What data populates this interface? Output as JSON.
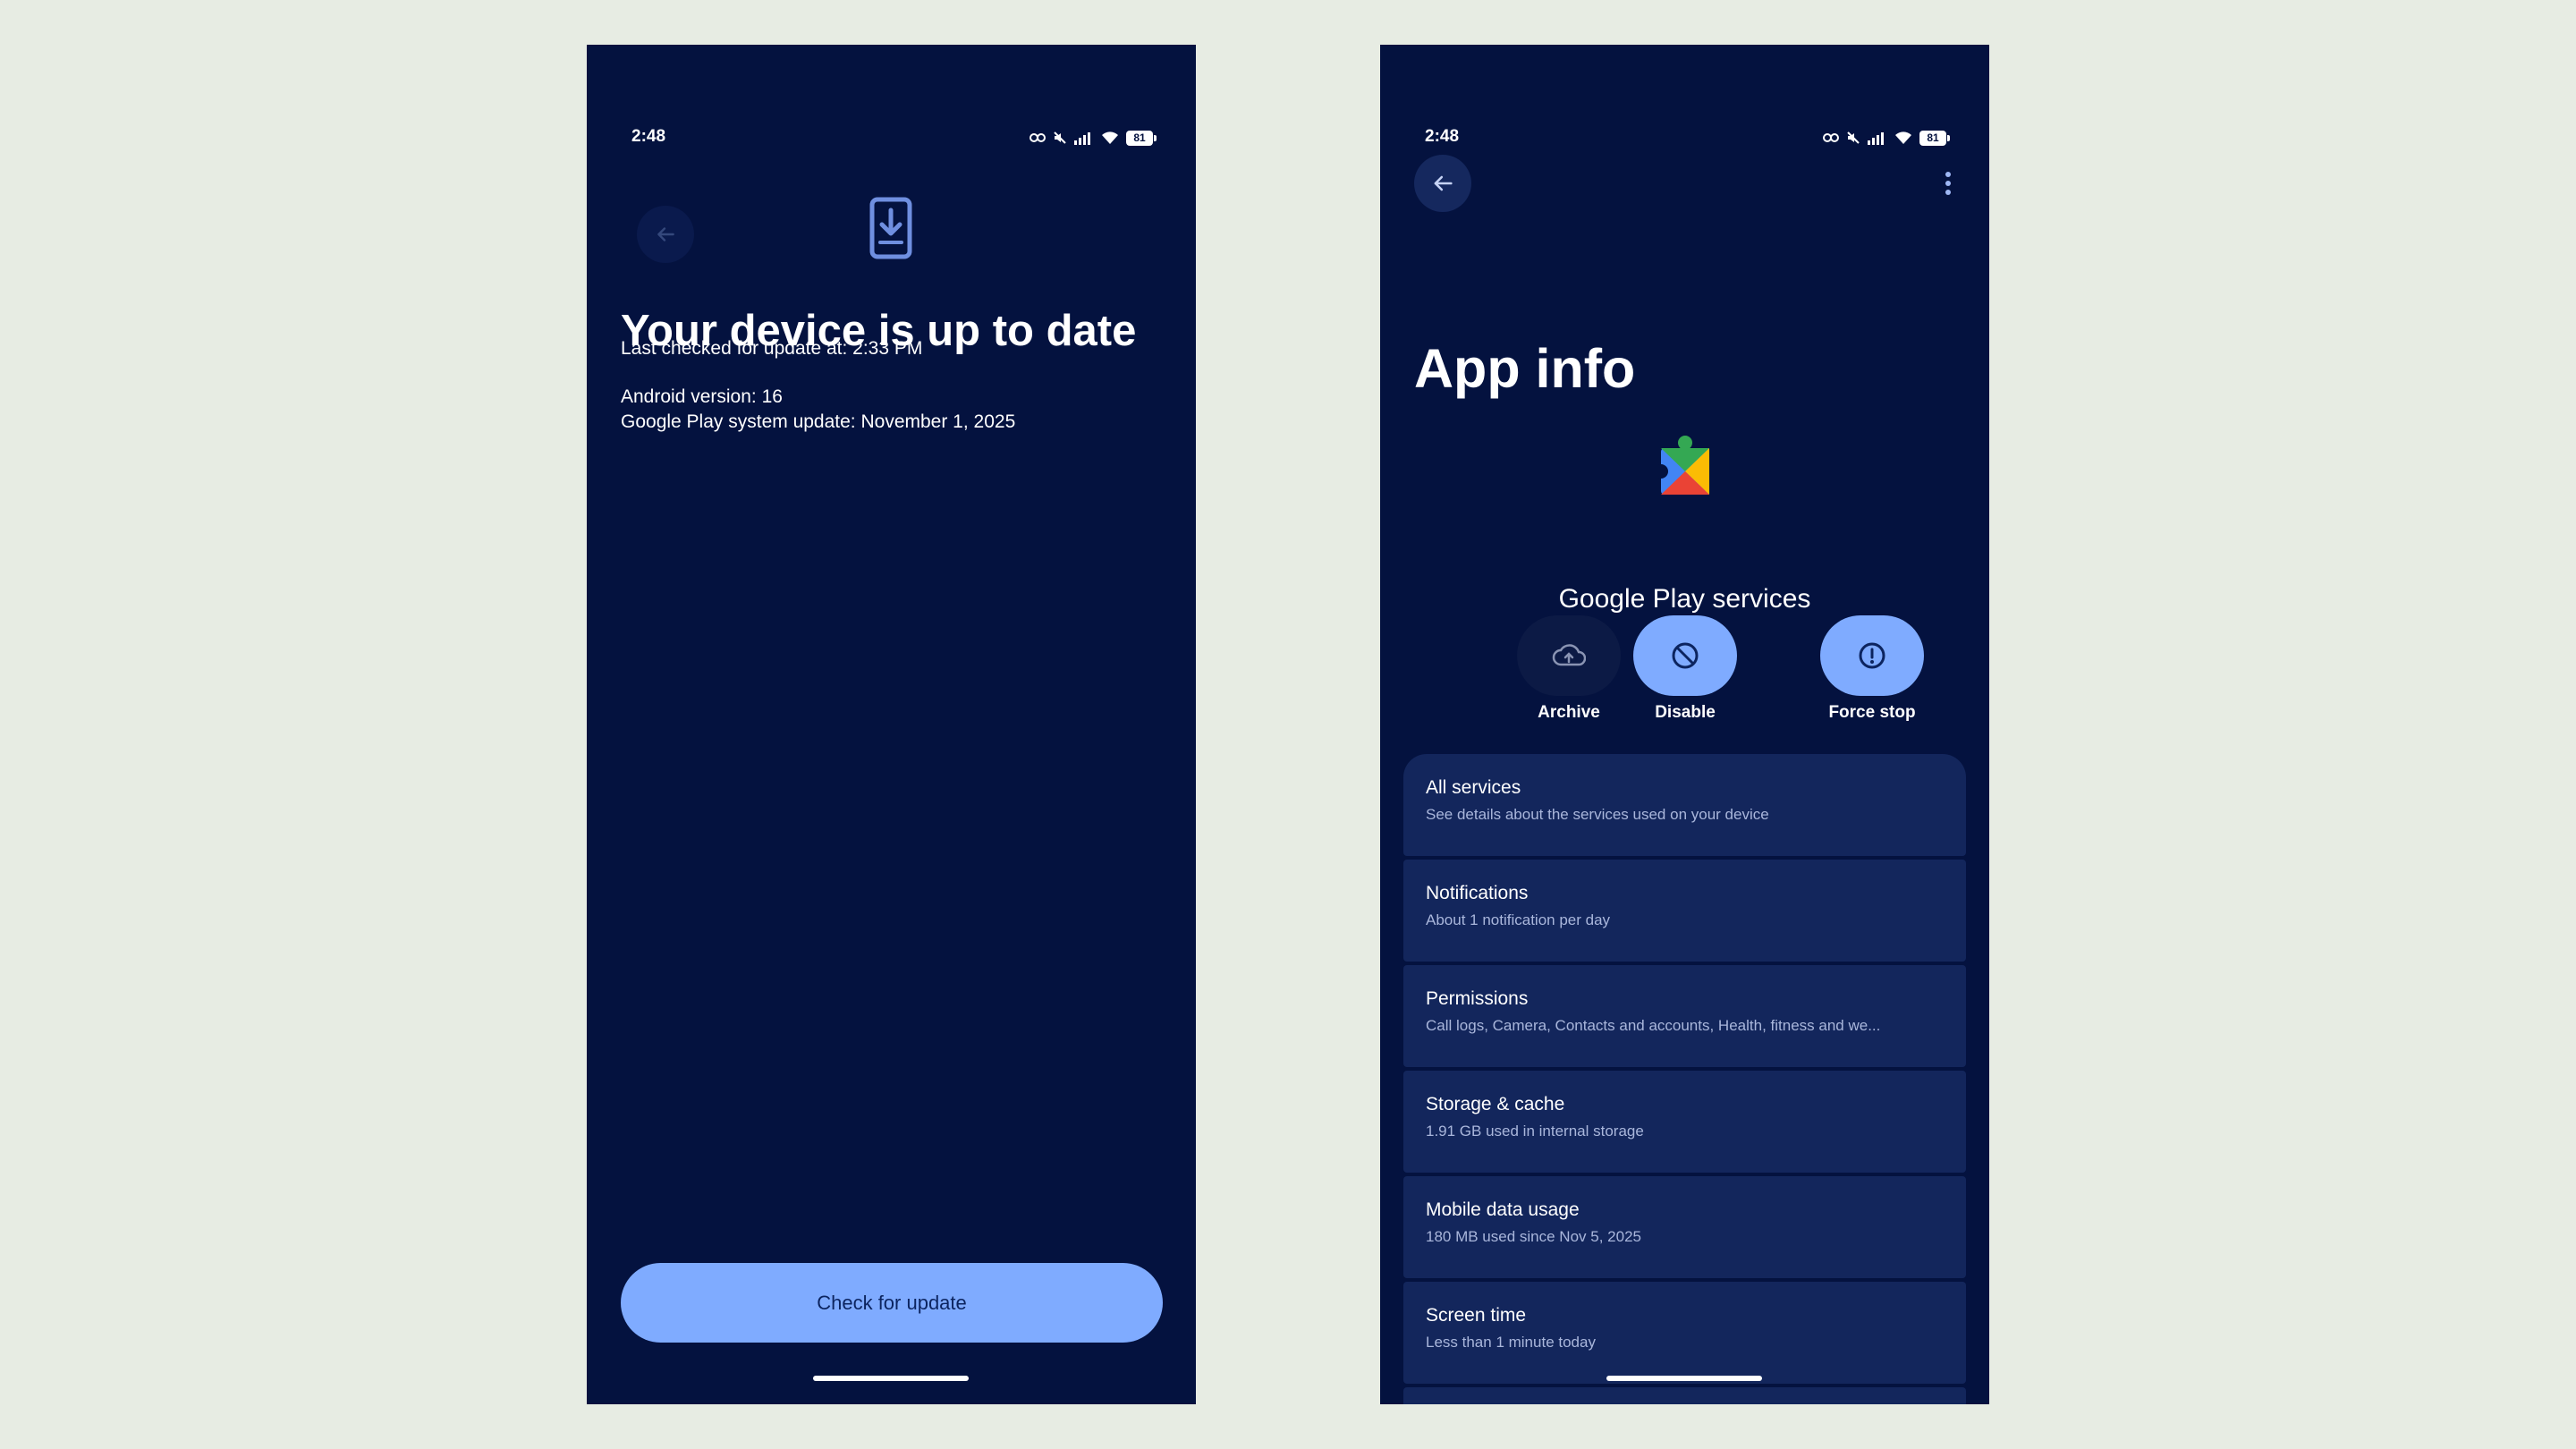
{
  "colors": {
    "background": "#e7ece3",
    "phone_bg": "#04123f",
    "card_bg": "#13265c",
    "accent": "#7fabff"
  },
  "left": {
    "status": {
      "time": "2:48",
      "battery": "81"
    },
    "title": "Your device is up to date",
    "last_checked": "Last checked for update at: 2:33 PM",
    "android_version": "Android version: 16",
    "play_update": "Google Play system update: November 1, 2025",
    "button_label": "Check for update"
  },
  "right": {
    "status": {
      "time": "2:48",
      "battery": "81"
    },
    "title": "App info",
    "app_name": "Google Play services",
    "actions": [
      {
        "label": "Archive",
        "icon": "cloud-upload-icon"
      },
      {
        "label": "Disable",
        "icon": "block-icon"
      },
      {
        "label": "Force stop",
        "icon": "alert-circle-icon"
      }
    ],
    "items": [
      {
        "title": "All services",
        "subtitle": "See details about the services used on your device"
      },
      {
        "title": "Notifications",
        "subtitle": "About 1 notification per day"
      },
      {
        "title": "Permissions",
        "subtitle": "Call logs, Camera, Contacts and accounts, Health, fitness and we..."
      },
      {
        "title": "Storage & cache",
        "subtitle": "1.91 GB used in internal storage"
      },
      {
        "title": "Mobile data usage",
        "subtitle": "180 MB used since Nov 5, 2025"
      },
      {
        "title": "Screen time",
        "subtitle": "Less than 1 minute today"
      }
    ]
  }
}
